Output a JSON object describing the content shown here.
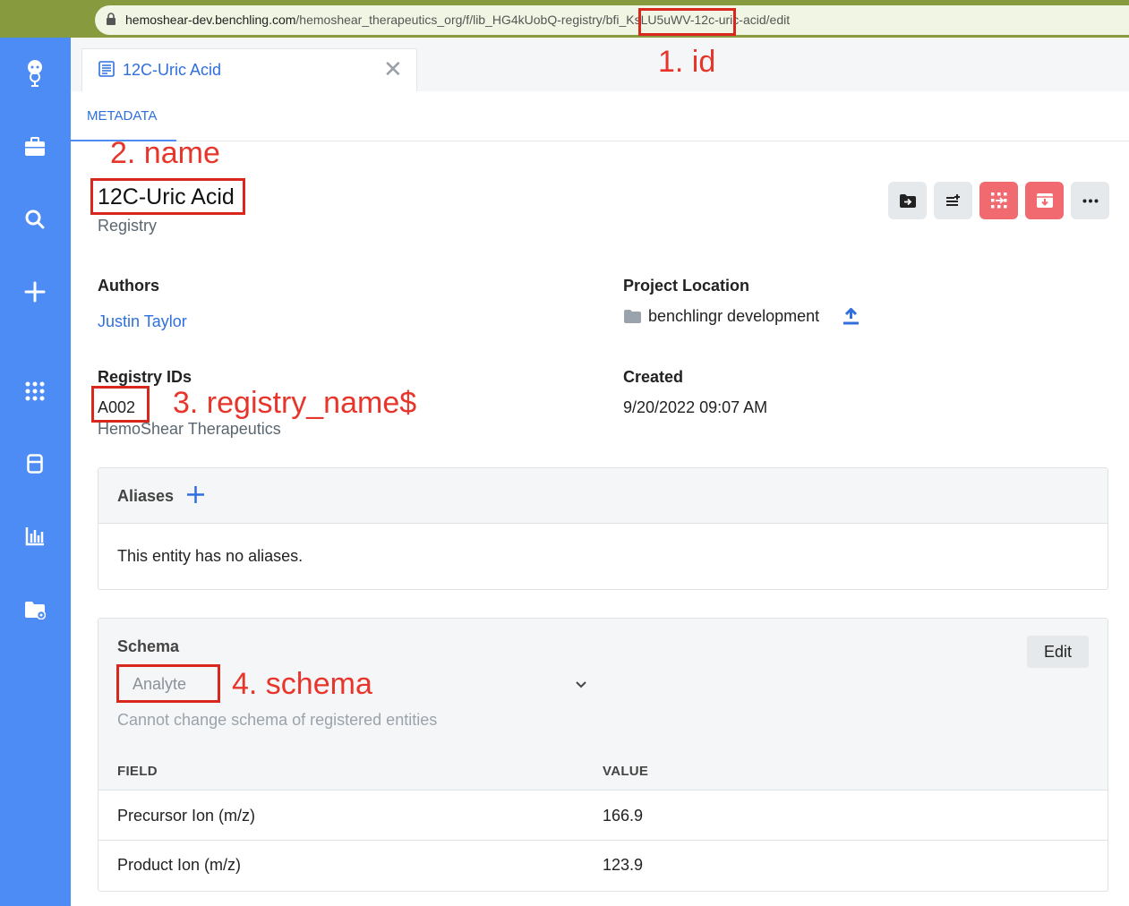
{
  "browser": {
    "url_domain": "hemoshear-dev.benchling.com",
    "url_path": "/hemoshear_therapeutics_org/f/lib_HG4kUobQ-registry/bfi_KsLU5uWV-12c-uric-acid/edit"
  },
  "sidebar": {
    "items": [
      "avatar-icon",
      "briefcase-icon",
      "search-icon",
      "plus-icon",
      "apps-grid-icon",
      "inventory-icon",
      "analytics-icon",
      "folder-settings-icon"
    ]
  },
  "tab": {
    "label": "12C-Uric Acid"
  },
  "subtab": {
    "label": "METADATA"
  },
  "annotations": {
    "a1": "1. id",
    "a2": "2. name",
    "a3": "3. registry_name$",
    "a4": "4. schema"
  },
  "entity": {
    "name": "12C-Uric Acid",
    "type": "Registry"
  },
  "details": {
    "authors_label": "Authors",
    "author": "Justin Taylor",
    "project_label": "Project Location",
    "project": "benchlingr development",
    "registry_ids_label": "Registry IDs",
    "registry_id": "A002",
    "registry_name": "HemoShear Therapeutics",
    "created_label": "Created",
    "created": "9/20/2022 09:07 AM"
  },
  "aliases": {
    "title": "Aliases",
    "empty": "This entity has no aliases."
  },
  "schema": {
    "title": "Schema",
    "edit_label": "Edit",
    "selected": "Analyte",
    "hint": "Cannot change schema of registered entities",
    "col_field": "FIELD",
    "col_value": "VALUE",
    "rows": [
      {
        "field": "Precursor Ion (m/z)",
        "value": "166.9"
      },
      {
        "field": "Product Ion (m/z)",
        "value": "123.9"
      }
    ]
  }
}
